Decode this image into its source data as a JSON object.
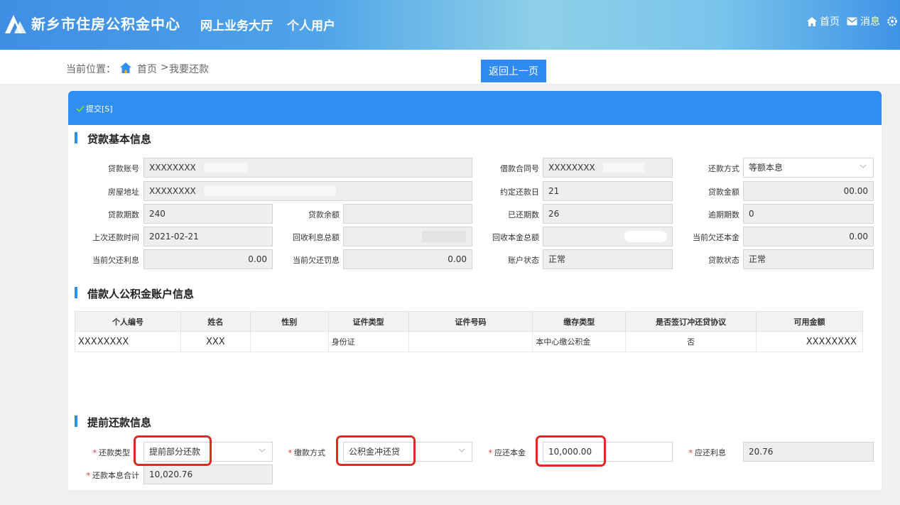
{
  "header": {
    "site_title": "新乡市住房公积金中心",
    "hall": "网上业务大厅",
    "user_type": "个人用户",
    "links": {
      "home": "首页",
      "messages": "消息"
    }
  },
  "breadcrumb": {
    "label": "当前位置：",
    "home": "首页",
    "separator": ">",
    "current": "我要还款",
    "back_button": "返回上一页"
  },
  "toolbar": {
    "submit": "提交[S]"
  },
  "loan_basic": {
    "title": "贷款基本信息",
    "fields": {
      "loan_account": {
        "label": "贷款账号",
        "value": "XXXXXXXX"
      },
      "contract_no": {
        "label": "借款合同号",
        "value": "XXXXXXXX"
      },
      "repay_method": {
        "label": "还款方式",
        "value": "等额本息"
      },
      "house_address": {
        "label": "房屋地址",
        "value": "XXXXXXXX"
      },
      "repay_day": {
        "label": "约定还款日",
        "value": "21"
      },
      "loan_amount": {
        "label": "贷款金额",
        "value": "00.00"
      },
      "loan_periods": {
        "label": "贷款期数",
        "value": "240"
      },
      "loan_balance": {
        "label": "贷款余额",
        "value": ""
      },
      "paid_periods": {
        "label": "已还期数",
        "value": "26"
      },
      "overdue_periods": {
        "label": "逾期期数",
        "value": "0"
      },
      "last_repay_time": {
        "label": "上次还款时间",
        "value": "2021-02-21"
      },
      "interest_recovered": {
        "label": "回收利息总额",
        "value": ""
      },
      "principal_recovered": {
        "label": "回收本金总额",
        "value": ""
      },
      "owed_principal": {
        "label": "当前欠还本金",
        "value": "0.00"
      },
      "owed_interest": {
        "label": "当前欠还利息",
        "value": "0.00"
      },
      "owed_penalty": {
        "label": "当前欠还罚息",
        "value": "0.00"
      },
      "account_status": {
        "label": "账户状态",
        "value": "正常"
      },
      "loan_status": {
        "label": "贷款状态",
        "value": "正常"
      }
    }
  },
  "borrower": {
    "title": "借款人公积金账户信息",
    "columns": [
      "个人编号",
      "姓名",
      "性别",
      "证件类型",
      "证件号码",
      "缴存类型",
      "是否签订冲还贷协议",
      "可用金额"
    ],
    "rows": [
      [
        "XXXXXXXX",
        "XXX",
        "",
        "身份证",
        "",
        "本中心缴公积金",
        "否",
        "XXXXXXXX"
      ]
    ]
  },
  "prepay": {
    "title": "提前还款信息",
    "repay_type": {
      "label": "还款类型",
      "value": "提前部分还款"
    },
    "pay_method": {
      "label": "缴款方式",
      "value": "公积金冲还贷"
    },
    "principal_due": {
      "label": "应还本金",
      "value": "10,000.00"
    },
    "interest_due": {
      "label": "应还利息",
      "value": "20.76"
    },
    "total_due": {
      "label": "还款本息合计",
      "value": "10,020.76"
    }
  },
  "colors": {
    "primary": "#2e8ef2",
    "highlight": "#e02a20",
    "required": "#e03030"
  }
}
